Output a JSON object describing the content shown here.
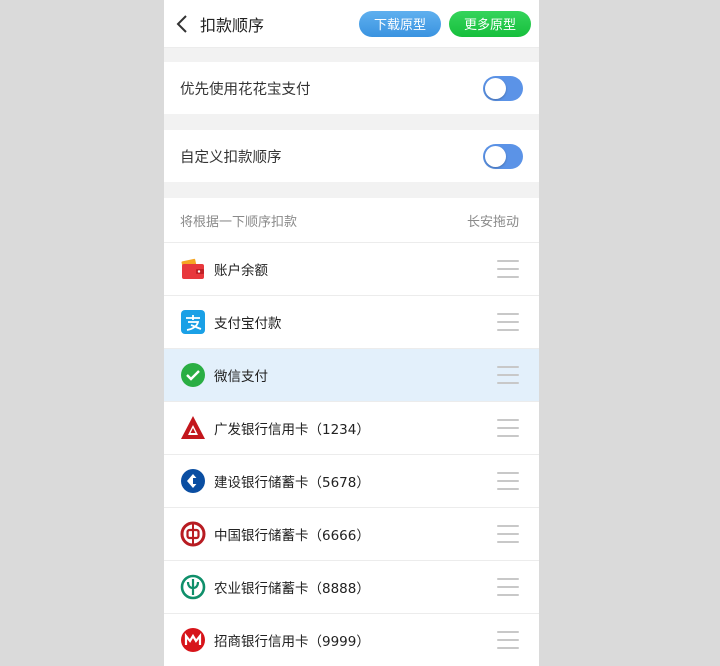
{
  "header": {
    "title": "扣款顺序",
    "download_label": "下载原型",
    "more_label": "更多原型"
  },
  "settings": {
    "huabei_label": "优先使用花花宝支付",
    "custom_order_label": "自定义扣款顺序"
  },
  "list": {
    "title": "将根据一下顺序扣款",
    "drag_hint": "长安拖动",
    "items": [
      {
        "label": "账户余额",
        "icon": "wallet-icon"
      },
      {
        "label": "支付宝付款",
        "icon": "alipay-icon"
      },
      {
        "label": "微信支付",
        "icon": "wechat-pay-icon"
      },
      {
        "label": "广发银行信用卡（1234）",
        "icon": "cgb-bank-icon"
      },
      {
        "label": "建设银行储蓄卡（5678）",
        "icon": "ccb-bank-icon"
      },
      {
        "label": "中国银行储蓄卡（6666）",
        "icon": "boc-bank-icon"
      },
      {
        "label": "农业银行储蓄卡（8888）",
        "icon": "abc-bank-icon"
      },
      {
        "label": "招商银行信用卡（9999）",
        "icon": "cmb-bank-icon"
      }
    ]
  },
  "colors": {
    "toggle_on": "#5b93e7",
    "download_button": "#3a93e0",
    "more_button": "#16bf3c",
    "highlight_row": "#e3f0fb"
  }
}
